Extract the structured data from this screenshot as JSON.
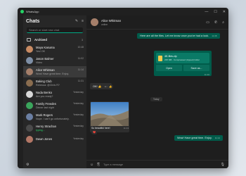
{
  "window": {
    "title": "WhatsApp"
  },
  "sidebar": {
    "title": "Chats",
    "search_placeholder": "Search or start new chat",
    "archived": {
      "label": "Archived",
      "count": "3"
    },
    "chats": [
      {
        "name": "Maya Kasuma",
        "time": "10:48",
        "preview": "Yes! OK",
        "color": "#c98b63",
        "green": false
      },
      {
        "name": "Jason Balmer",
        "time": "11:02",
        "preview": "Video",
        "color": "#7e8fa6",
        "green": false
      },
      {
        "name": "Alice Whitman",
        "time": "11:14",
        "preview": "Wow! Have great time. Enjoy.",
        "color": "#a57f6a",
        "green": false
      },
      {
        "name": "Baking Club",
        "time": "11:31",
        "preview": "Rebecca: @Chris R?",
        "color": "#8a6d4f",
        "green": false
      },
      {
        "name": "Nada Benko",
        "time": "Yesterday",
        "preview": "Are you ready?",
        "color": "#d8d8d8",
        "green": false
      },
      {
        "name": "Family Freedes",
        "time": "Yesterday",
        "preview": "Dinner last night",
        "color": "#3ba55c",
        "green": false
      },
      {
        "name": "Mark Rogers",
        "time": "Yesterday",
        "preview": "Nope. I can't go unfortunately.",
        "color": "#6b7fa3",
        "green": false
      },
      {
        "name": "Henry Strachan",
        "time": "Yesterday",
        "preview": "typing...",
        "color": "#4a4a4a",
        "green": true
      },
      {
        "name": "Dawn Jones",
        "time": "Yesterday",
        "preview": "",
        "color": "#b37766",
        "green": false
      }
    ]
  },
  "contact": {
    "name": "Alice Whitman",
    "status": "online"
  },
  "messages": {
    "m1": {
      "text": "Here are all the files. Let me know once you've had a look.",
      "time": "11:08"
    },
    "file": {
      "name": "4K-files.zip",
      "meta": "235 MB · Compressed (zipped) folder",
      "open": "Open",
      "save": "Save as...",
      "time": "11:10"
    },
    "m2": {
      "text": "OK! 👍",
      "time": "11:11"
    },
    "m2_reaction": "👍",
    "date_label": "Today",
    "photo": {
      "caption": "So beautiful here!",
      "time": "11:13"
    },
    "photo_reaction": "❤️",
    "m3": {
      "text": "Wow! Have great time. Enjoy.",
      "time": "11:14"
    }
  },
  "composer": {
    "placeholder": "Type a message"
  },
  "colors": {
    "accent": "#00a884",
    "outgoing_bubble": "#005c4b",
    "window_bg": "#202020"
  }
}
